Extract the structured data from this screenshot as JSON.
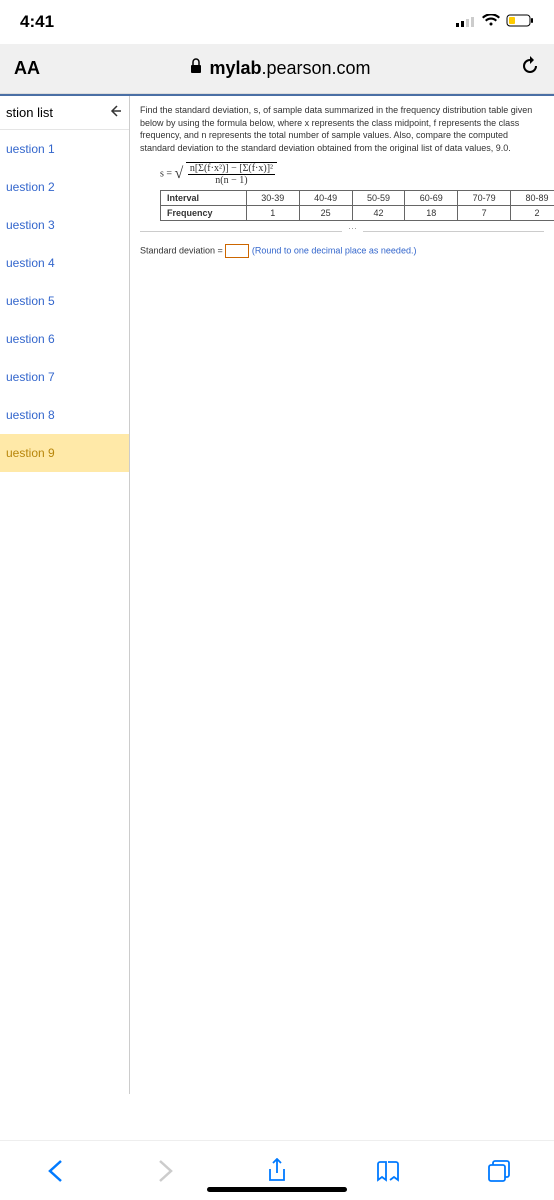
{
  "status": {
    "time": "4:41"
  },
  "browser": {
    "aa": "AA",
    "domain_prefix": "mylab",
    "domain_suffix": ".pearson.com"
  },
  "sidebar": {
    "header": "stion list",
    "items": [
      {
        "label": "uestion 1"
      },
      {
        "label": "uestion 2"
      },
      {
        "label": "uestion 3"
      },
      {
        "label": "uestion 4"
      },
      {
        "label": "uestion 5"
      },
      {
        "label": "uestion 6"
      },
      {
        "label": "uestion 7"
      },
      {
        "label": "uestion 8"
      },
      {
        "label": "uestion 9"
      }
    ]
  },
  "problem": {
    "instruction": "Find the standard deviation, s, of sample data summarized in the frequency distribution table given below by using the formula below, where x represents the class midpoint, f represents the class frequency, and n represents the total number of sample values. Also, compare the computed standard deviation to the standard deviation obtained from the original list of data values, 9.0.",
    "formula_lhs": "s =",
    "formula_num": "n[Σ(f·x²)] − [Σ(f·x)]²",
    "formula_den": "n(n − 1)",
    "table": {
      "row1_label": "Interval",
      "row2_label": "Frequency",
      "cols": [
        "30-39",
        "40-49",
        "50-59",
        "60-69",
        "70-79",
        "80-89"
      ],
      "freq": [
        "1",
        "25",
        "42",
        "18",
        "7",
        "2"
      ]
    },
    "answer_label": "Standard deviation =",
    "answer_hint": "(Round to one decimal place as needed.)"
  }
}
